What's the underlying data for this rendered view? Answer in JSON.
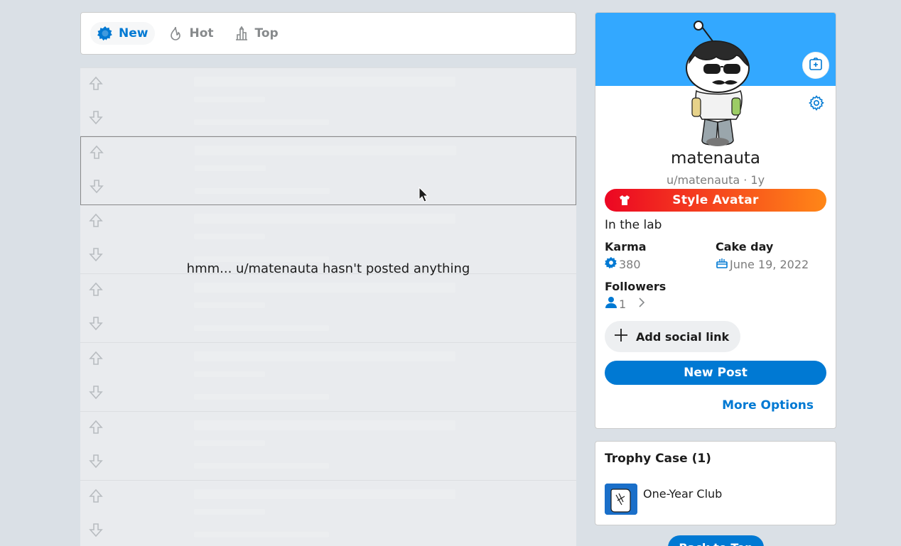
{
  "sort": {
    "tabs": [
      {
        "label": "New",
        "icon": "burst-icon",
        "active": true
      },
      {
        "label": "Hot",
        "icon": "flame-icon",
        "active": false
      },
      {
        "label": "Top",
        "icon": "top-chart-icon",
        "active": false
      }
    ]
  },
  "feed": {
    "empty_message": "hmm... u/matenauta hasn't posted anything"
  },
  "profile": {
    "username": "matenauta",
    "handle": "u/matenauta · 1y",
    "style_avatar_label": "Style Avatar",
    "bio": "In the lab",
    "karma_label": "Karma",
    "karma_value": "380",
    "cakeday_label": "Cake day",
    "cakeday_value": "June 19, 2022",
    "followers_label": "Followers",
    "followers_value": "1",
    "add_social_label": "Add social link",
    "new_post_label": "New Post",
    "more_options_label": "More Options"
  },
  "trophy": {
    "title": "Trophy Case (1)",
    "items": [
      {
        "name": "One-Year Club"
      }
    ]
  },
  "back_to_top_label": "Back to Top",
  "colors": {
    "accent": "#0079d3",
    "banner": "#33a8ff",
    "page_bg": "#dae0e6",
    "style_avatar_gradient_start": "#ec0623",
    "style_avatar_gradient_end": "#ff8717"
  }
}
